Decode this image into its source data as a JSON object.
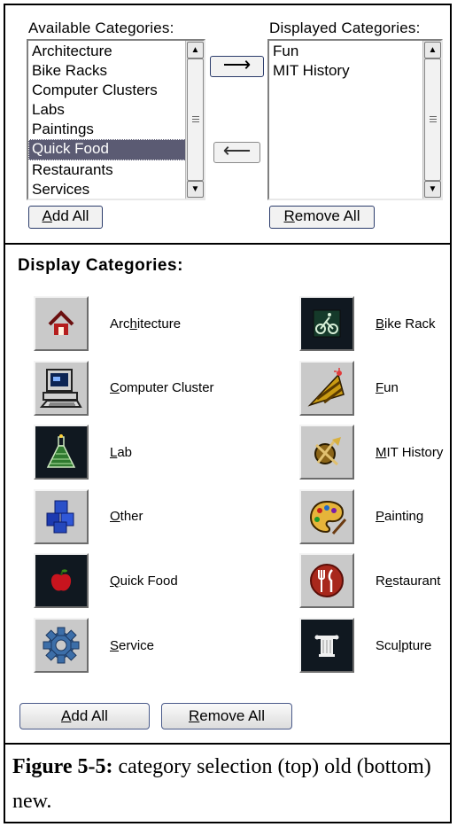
{
  "old_ui": {
    "available": {
      "label": "Available Categories:",
      "items": [
        "Architecture",
        "Bike Racks",
        "Computer Clusters",
        "Labs",
        "Paintings",
        "Quick Food",
        "Restaurants",
        "Services"
      ],
      "selected_index": 5
    },
    "displayed": {
      "label": "Displayed Categories:",
      "items": [
        "Fun",
        "MIT History"
      ]
    },
    "move_right_glyph": "⟶",
    "move_left_glyph": "⟵",
    "add_all": {
      "pre": "",
      "key": "A",
      "post": "dd All"
    },
    "remove_all": {
      "pre": "",
      "key": "R",
      "post": "emove All"
    }
  },
  "new_ui": {
    "heading": "Display Categories:",
    "categories": [
      {
        "pre": "Arc",
        "key": "h",
        "post": "itecture",
        "icon": "house-icon"
      },
      {
        "pre": "",
        "key": "B",
        "post": "ike Rack",
        "icon": "bike-icon"
      },
      {
        "pre": "",
        "key": "C",
        "post": "omputer Cluster",
        "icon": "computer-icon"
      },
      {
        "pre": "",
        "key": "F",
        "post": "un",
        "icon": "party-hat-icon"
      },
      {
        "pre": "",
        "key": "L",
        "post": "ab",
        "icon": "flask-icon"
      },
      {
        "pre": "",
        "key": "M",
        "post": "IT History",
        "icon": "history-icon"
      },
      {
        "pre": "",
        "key": "O",
        "post": "ther",
        "icon": "blocks-icon"
      },
      {
        "pre": "",
        "key": "P",
        "post": "ainting",
        "icon": "palette-icon"
      },
      {
        "pre": "",
        "key": "Q",
        "post": "uick Food",
        "icon": "apple-icon"
      },
      {
        "pre": "R",
        "key": "e",
        "post": "staurant",
        "icon": "fork-knife-icon"
      },
      {
        "pre": "",
        "key": "S",
        "post": "ervice",
        "icon": "gear-icon"
      },
      {
        "pre": "Scu",
        "key": "l",
        "post": "pture",
        "icon": "column-icon"
      }
    ],
    "add_all": {
      "pre": "",
      "key": "A",
      "post": "dd All"
    },
    "remove_all": {
      "pre": "",
      "key": "R",
      "post": "emove All"
    }
  },
  "caption": {
    "bold": "Figure 5-5:",
    "text": " category selection (top) old (bottom) new."
  }
}
